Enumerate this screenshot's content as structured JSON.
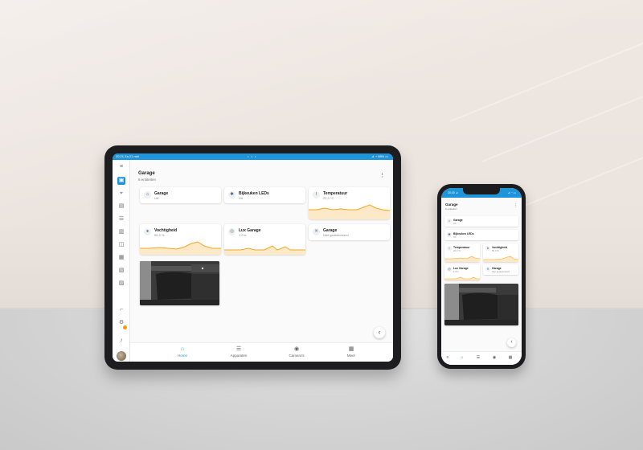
{
  "tablet": {
    "status": {
      "time_date": "20:21  Za 21 mei",
      "dots": "• • •",
      "right": "⊿ ◔ 98% ▭"
    },
    "page_title": "Garage",
    "page_subtitle": "6 entiteiten",
    "more_icon": "⋮",
    "cards": [
      {
        "name": "Garage",
        "state": "Uit",
        "icon": "garage-icon",
        "glyph": "⌂"
      },
      {
        "name": "Bijkeuken LEDs",
        "state": "Uit",
        "icon": "bulb-icon",
        "glyph": "✱"
      },
      {
        "name": "Temperatuur",
        "state": "22,3 °C",
        "icon": "thermometer-icon",
        "glyph": "ǀ"
      },
      {
        "name": "Vochtigheid",
        "state": "55,3 %",
        "icon": "water-drop-icon",
        "glyph": "●"
      },
      {
        "name": "Lux Garage",
        "state": "1,0 lx",
        "icon": "lux-icon",
        "glyph": "◎"
      },
      {
        "name": "Garage",
        "state": "Niet gedetecteerd",
        "icon": "motion-off-icon",
        "glyph": "✕"
      }
    ],
    "tabs": [
      {
        "label": "Home",
        "glyph": "⌂"
      },
      {
        "label": "Apparaten",
        "glyph": "☰"
      },
      {
        "label": "Camera's",
        "glyph": "◉"
      },
      {
        "label": "Meer",
        "glyph": "▦"
      }
    ],
    "sidebar_glyphs": [
      "≡",
      "▣",
      "⌖",
      "▤",
      "☰",
      "▥",
      "◫",
      "▦",
      "▧",
      "▨",
      "⌐",
      "⚙",
      "♪"
    ]
  },
  "phone": {
    "status": {
      "time": "20:20 ⊿",
      "right": "⊿ ◔ ▭"
    },
    "page_title": "Garage",
    "page_subtitle": "6 entiteiten",
    "more_icon": "⋮",
    "cards": [
      {
        "name": "Garage",
        "state": "Uit",
        "icon": "garage-icon",
        "glyph": "⌂"
      },
      {
        "name": "Bijkeuken LEDs",
        "state": "Uit",
        "icon": "bulb-icon",
        "glyph": "✱"
      },
      {
        "name": "Temperatuur",
        "state": "22,3 °C",
        "icon": "thermometer-icon",
        "glyph": "ǀ"
      },
      {
        "name": "Vochtigheid",
        "state": "55,3 %",
        "icon": "water-drop-icon",
        "glyph": "●"
      },
      {
        "name": "Lux Garage",
        "state": "1,0 lx",
        "icon": "lux-icon",
        "glyph": "◎"
      },
      {
        "name": "Garage",
        "state": "Niet gedetecteerd",
        "icon": "motion-off-icon",
        "glyph": "✕"
      }
    ],
    "tab_glyphs": [
      "≡",
      "⌂",
      "☰",
      "◉",
      "▦"
    ]
  },
  "back_glyph": "‹",
  "colors": {
    "accent": "#1e95d8",
    "graph_line": "#f5a623",
    "graph_fill": "#fde9c8",
    "badge": "#ff9800"
  }
}
